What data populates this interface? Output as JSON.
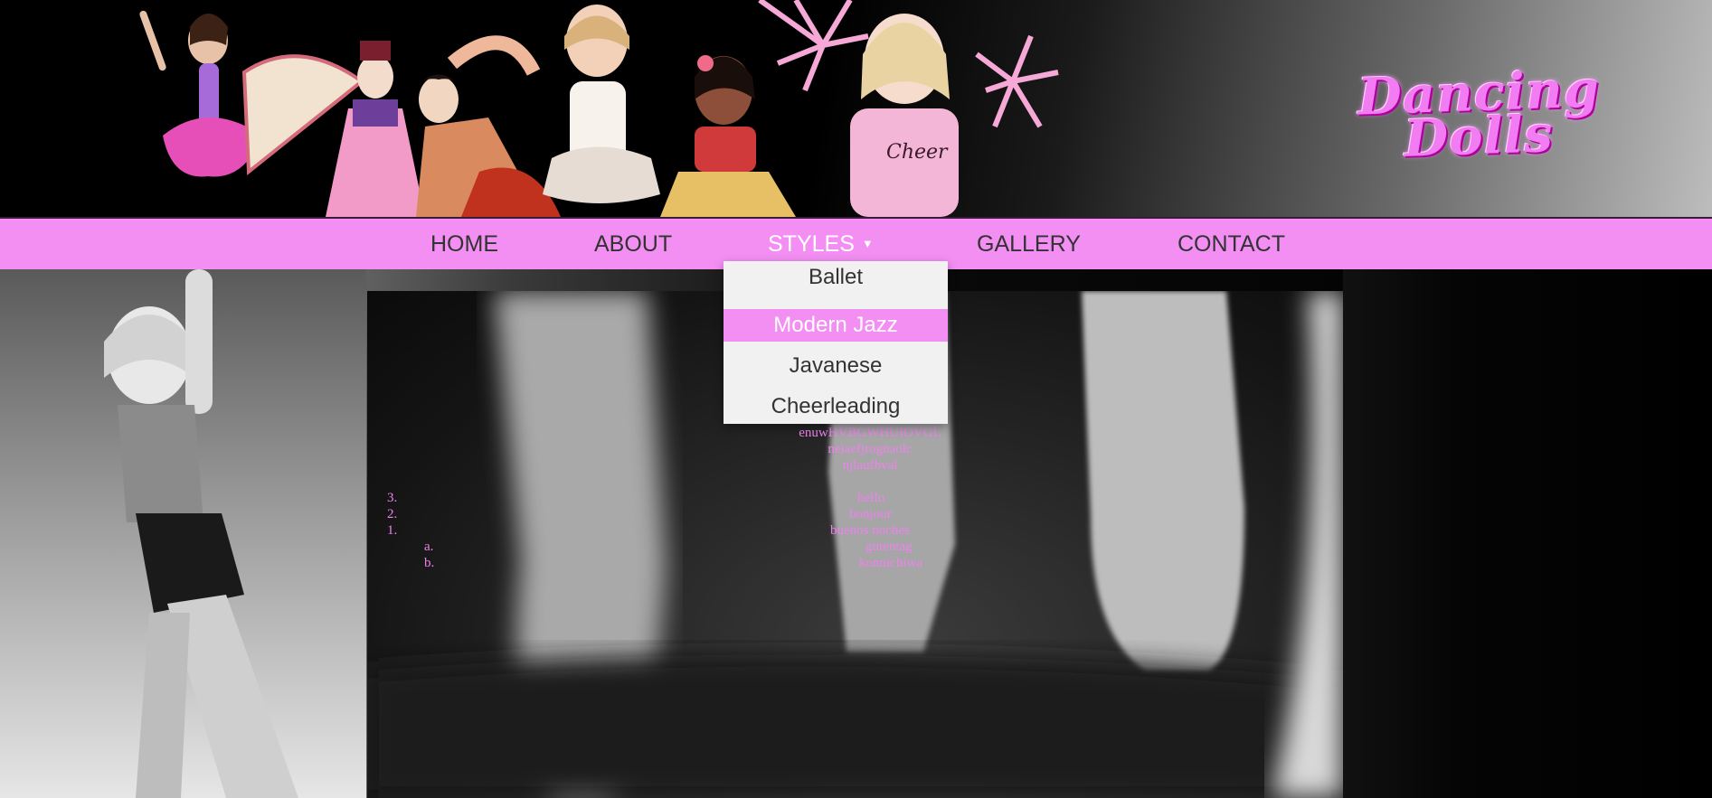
{
  "header": {
    "logo_line1": "Dancing",
    "logo_line2": "Dolls"
  },
  "nav": {
    "items": [
      {
        "label": "HOME"
      },
      {
        "label": "ABOUT"
      },
      {
        "label": "STYLES",
        "caret": "▼"
      },
      {
        "label": "GALLERY"
      },
      {
        "label": "CONTACT"
      }
    ]
  },
  "styles_menu": {
    "items": [
      {
        "label": "Ballet"
      },
      {
        "label": "Modern Jazz"
      },
      {
        "label": "Javanese"
      },
      {
        "label": "Cheerleading"
      }
    ]
  },
  "content": {
    "center_lines": [
      "enuwHVBGWHUIOVGL",
      "neiaefjrognaolc",
      "njlaufhval"
    ],
    "greetings": [
      "hello",
      "bonjour",
      "buenos noches",
      "gutentag",
      "konnichiwa"
    ],
    "ordered_markers": [
      "3.",
      "2.",
      "1."
    ],
    "sub_markers": [
      "a.",
      "b."
    ]
  },
  "colors": {
    "nav_bg": "#f38ef3",
    "accent_text": "#ee82ee",
    "dropdown_bg": "#f1f1f1"
  }
}
